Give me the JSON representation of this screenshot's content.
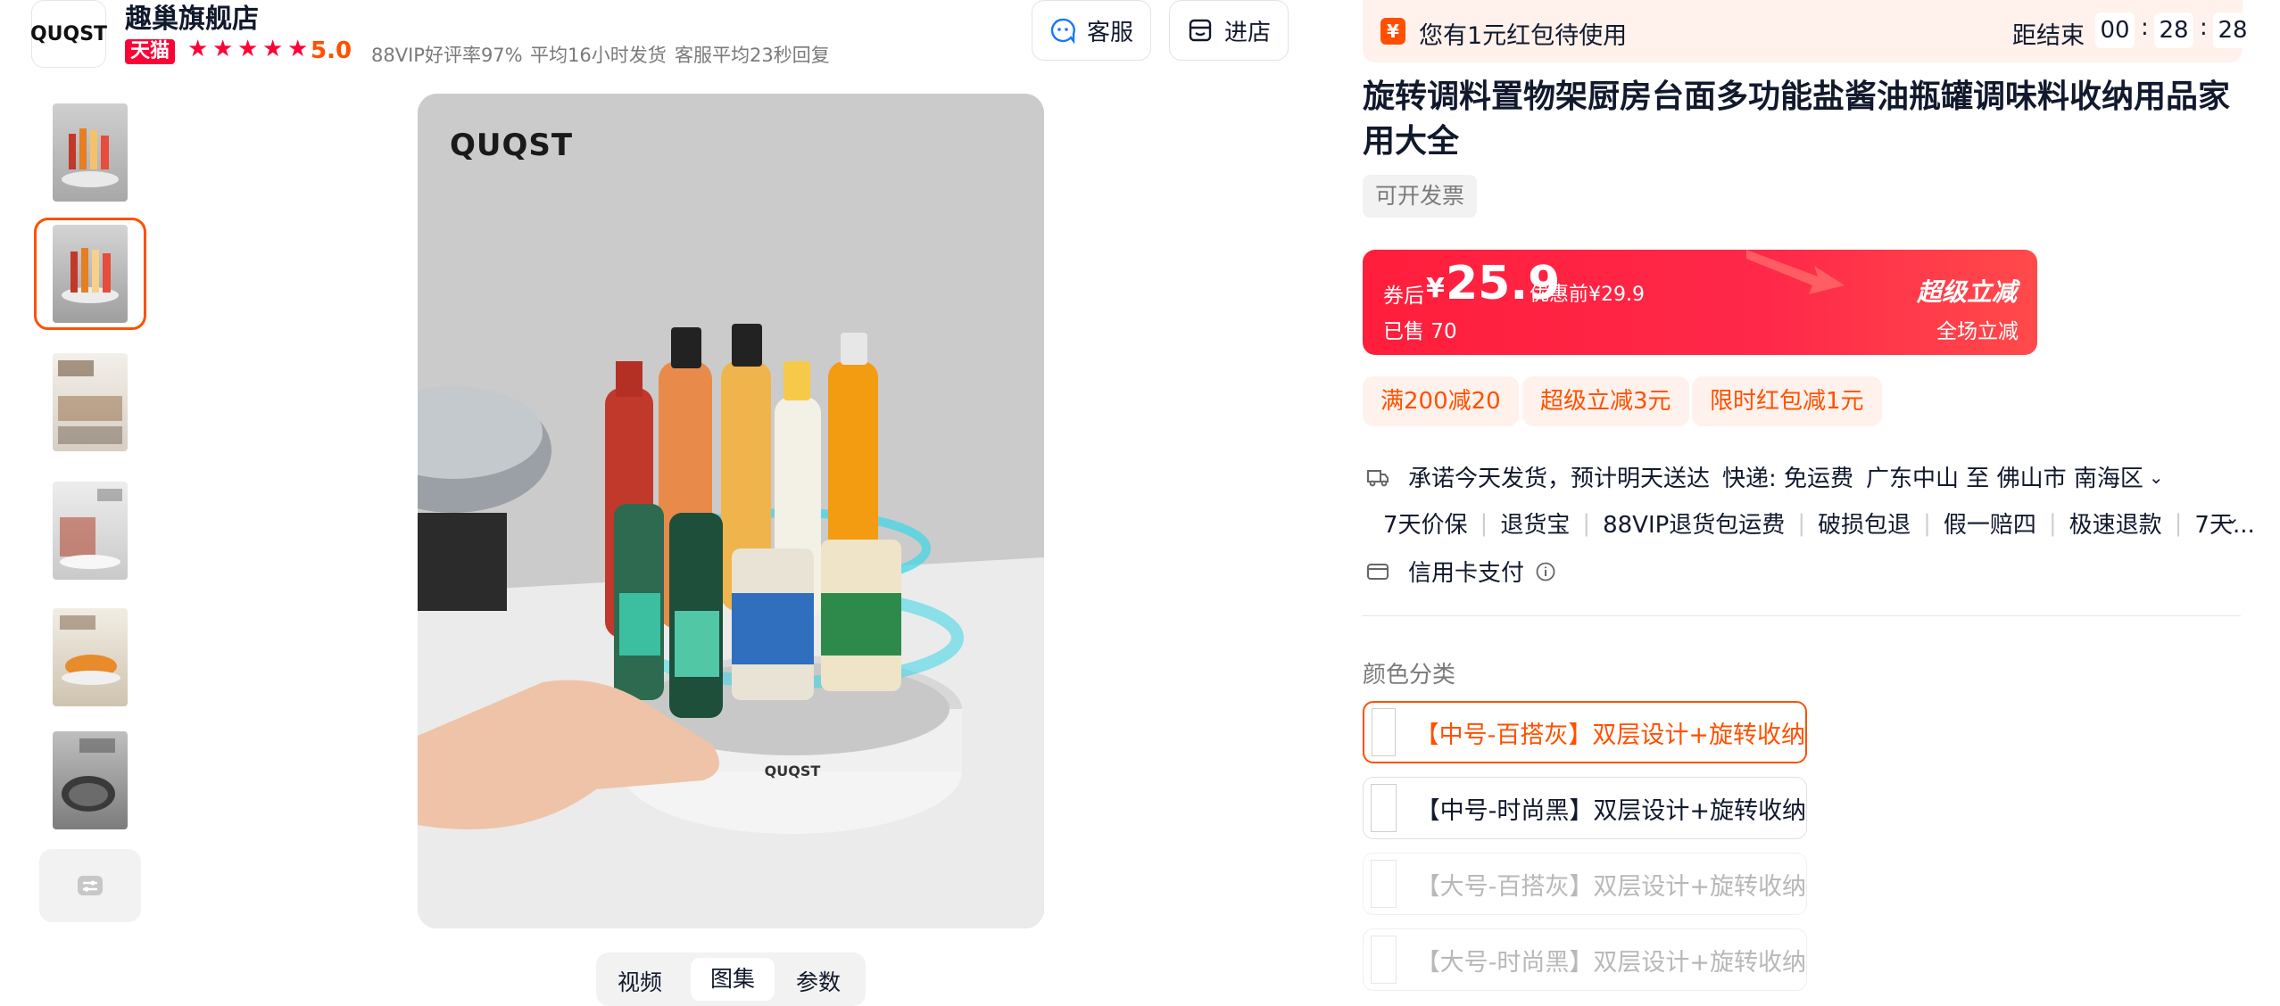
{
  "store": {
    "logo_text": "QUQST",
    "name": "趣巢旗舰店",
    "platform_badge": "天猫",
    "rating": "5.0",
    "stats": [
      "88VIP好评率97%",
      "平均16小时发货",
      "客服平均23秒回复"
    ]
  },
  "header_buttons": {
    "service": "客服",
    "store": "进店"
  },
  "gallery": {
    "selected_index": 1,
    "thumb_count": 6,
    "image_brand": "QUQST",
    "tabs": [
      "视频",
      "图集",
      "参数"
    ]
  },
  "red_packet_bar": {
    "text": "您有1元红包待使用",
    "countdown_label": "距结束",
    "hours": "00",
    "minutes": "28",
    "seconds": "28"
  },
  "product": {
    "title": "旋转调料置物架厨房台面多功能盐酱油瓶罐调味料收纳用品家用大全",
    "invoice_tag": "可开发票"
  },
  "price": {
    "after_coupon_label": "券后",
    "currency": "¥",
    "value": "25.9",
    "before_label": "优惠前¥29.9",
    "sold": "已售 70",
    "promo_title": "超级立减",
    "promo_sub": "全场立减"
  },
  "coupons": [
    "满200减20",
    "超级立减3元",
    "限时红包减1元"
  ],
  "services": {
    "shipping": {
      "promise": "承诺今天发货，预计明天送达",
      "delivery": "快递: 免运费",
      "route": "广东中山 至 佛山市 南海区"
    },
    "guarantees": [
      "7天价保",
      "退货宝",
      "88VIP退货包运费",
      "破损包退",
      "假一赔四",
      "极速退款",
      "7天..."
    ],
    "payment": "信用卡支付"
  },
  "sku": {
    "label": "颜色分类",
    "options": [
      {
        "text": "【中号-百搭灰】双层设计+旋转收纳",
        "state": "selected"
      },
      {
        "text": "【中号-时尚黑】双层设计+旋转收纳",
        "state": "normal"
      },
      {
        "text": "【大号-百搭灰】双层设计+旋转收纳",
        "state": "disabled"
      },
      {
        "text": "【大号-时尚黑】双层设计+旋转收纳",
        "state": "disabled"
      }
    ]
  },
  "colors": {
    "accent": "#ff5000",
    "price_red": "#ff1e3c",
    "tmall_red": "#ff0036",
    "text": "#11192d",
    "muted": "#7a7a7a"
  }
}
